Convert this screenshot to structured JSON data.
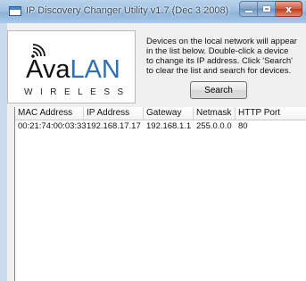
{
  "window": {
    "title": "IP Discovery Changer Utility v1.7 (Dec  3 2008)",
    "buttons": {
      "minimize": "minimize",
      "maximize": "maximize",
      "close": "x"
    }
  },
  "logo": {
    "brand_dark": "Ava",
    "brand_blue": "LAN",
    "subtitle": "WIRELESS",
    "icon": "wireless-signal-icon",
    "colors": {
      "dark": "#111111",
      "blue": "#2e6fb5"
    }
  },
  "info": {
    "text": "Devices on the local network will appear in the list below. Double-click a device to change its IP address. Click 'Search' to clear the list and search for devices."
  },
  "toolbar": {
    "search_label": "Search"
  },
  "devices": {
    "columns": [
      "MAC Address",
      "IP Address",
      "Gateway",
      "Netmask",
      "HTTP Port"
    ],
    "rows": [
      [
        "00:21:74:00:03:33",
        "192.168.17.17",
        "192.168.1.1",
        "255.0.0.0",
        "80"
      ]
    ]
  }
}
